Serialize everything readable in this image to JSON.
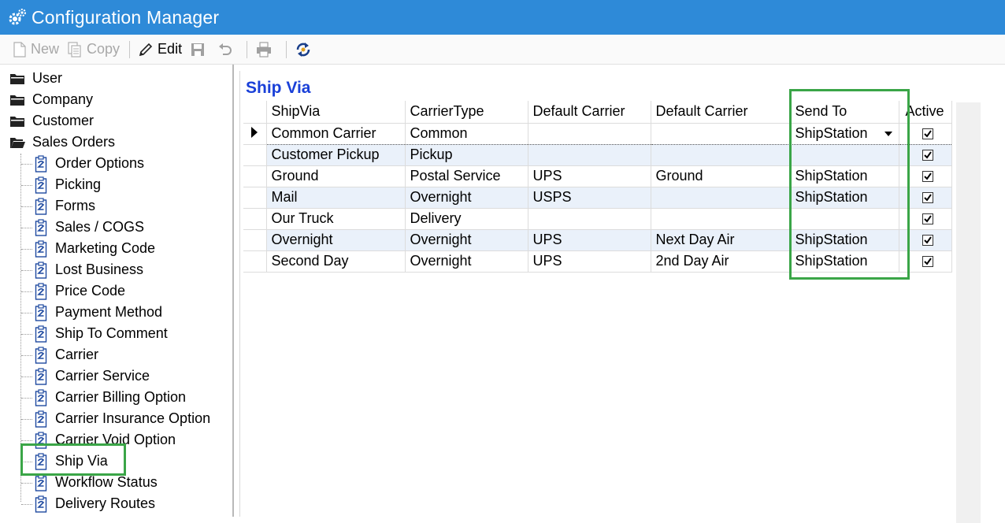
{
  "window": {
    "title": "Configuration Manager"
  },
  "toolbar": {
    "new_label": "New",
    "copy_label": "Copy",
    "edit_label": "Edit"
  },
  "sidebar": {
    "folders": [
      {
        "label": "User",
        "icon": "folder-closed-icon"
      },
      {
        "label": "Company",
        "icon": "folder-closed-icon"
      },
      {
        "label": "Customer",
        "icon": "folder-closed-icon"
      },
      {
        "label": "Sales Orders",
        "icon": "folder-open-icon"
      }
    ],
    "items": [
      {
        "label": "Order Options"
      },
      {
        "label": "Picking"
      },
      {
        "label": "Forms"
      },
      {
        "label": "Sales / COGS"
      },
      {
        "label": "Marketing Code"
      },
      {
        "label": "Lost Business"
      },
      {
        "label": "Price Code"
      },
      {
        "label": "Payment Method"
      },
      {
        "label": "Ship To Comment"
      },
      {
        "label": "Carrier"
      },
      {
        "label": "Carrier Service"
      },
      {
        "label": "Carrier Billing Option"
      },
      {
        "label": "Carrier Insurance Option"
      },
      {
        "label": "Carrier Void Option"
      },
      {
        "label": "Ship Via"
      },
      {
        "label": "Workflow Status"
      },
      {
        "label": "Delivery Routes"
      }
    ],
    "selected": "Ship Via"
  },
  "main": {
    "title": "Ship Via",
    "columns": [
      "ShipVia",
      "CarrierType",
      "Default Carrier",
      "Default Carrier",
      "Send To",
      "Active"
    ],
    "rows": [
      {
        "shipvia": "Common Carrier",
        "carrier_type": "Common",
        "default_carrier_1": "",
        "default_carrier_2": "",
        "send_to": "ShipStation",
        "active": true
      },
      {
        "shipvia": "Customer Pickup",
        "carrier_type": "Pickup",
        "default_carrier_1": "",
        "default_carrier_2": "",
        "send_to": "",
        "active": true
      },
      {
        "shipvia": "Ground",
        "carrier_type": "Postal Service",
        "default_carrier_1": "UPS",
        "default_carrier_2": "Ground",
        "send_to": "ShipStation",
        "active": true
      },
      {
        "shipvia": "Mail",
        "carrier_type": "Overnight",
        "default_carrier_1": "USPS",
        "default_carrier_2": "",
        "send_to": "ShipStation",
        "active": true
      },
      {
        "shipvia": "Our Truck",
        "carrier_type": "Delivery",
        "default_carrier_1": "",
        "default_carrier_2": "",
        "send_to": "",
        "active": true
      },
      {
        "shipvia": "Overnight",
        "carrier_type": "Overnight",
        "default_carrier_1": "UPS",
        "default_carrier_2": "Next Day Air",
        "send_to": "ShipStation",
        "active": true
      },
      {
        "shipvia": "Second Day",
        "carrier_type": "Overnight",
        "default_carrier_1": "UPS",
        "default_carrier_2": "2nd Day Air",
        "send_to": "ShipStation",
        "active": true
      }
    ]
  },
  "colors": {
    "titlebar": "#2e8ad8",
    "page_title": "#1a40d8",
    "highlight": "#3aa547",
    "alt_row": "#eaf1fa"
  }
}
